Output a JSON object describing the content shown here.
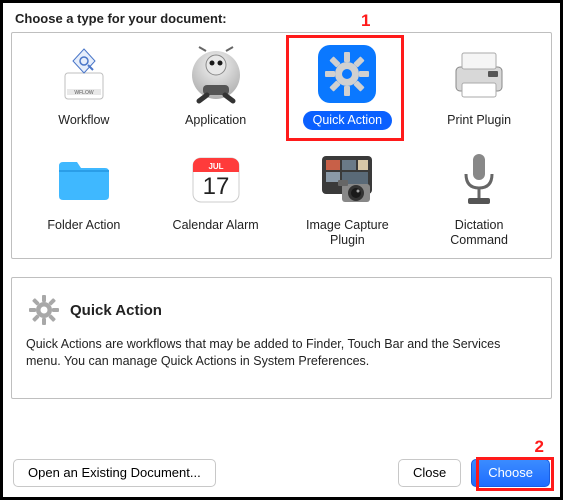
{
  "heading": "Choose a type for your document:",
  "types": [
    {
      "label": "Workflow",
      "icon": "workflow-icon",
      "selected": false
    },
    {
      "label": "Application",
      "icon": "application-icon",
      "selected": false
    },
    {
      "label": "Quick Action",
      "icon": "gear-icon",
      "selected": true
    },
    {
      "label": "Print Plugin",
      "icon": "printer-icon",
      "selected": false
    },
    {
      "label": "Folder Action",
      "icon": "folder-icon",
      "selected": false
    },
    {
      "label": "Calendar Alarm",
      "icon": "calendar-icon",
      "selected": false
    },
    {
      "label": "Image Capture Plugin",
      "icon": "camera-icon",
      "selected": false
    },
    {
      "label": "Dictation Command",
      "icon": "microphone-icon",
      "selected": false
    }
  ],
  "calendar": {
    "month": "JUL",
    "day": "17"
  },
  "description": {
    "title": "Quick Action",
    "text": "Quick Actions are workflows that may be added to Finder, Touch Bar and the Services menu. You can manage Quick Actions in System Preferences."
  },
  "buttons": {
    "open_existing": "Open an Existing Document...",
    "close": "Close",
    "choose": "Choose"
  },
  "annotations": {
    "n1": "1",
    "n2": "2"
  }
}
